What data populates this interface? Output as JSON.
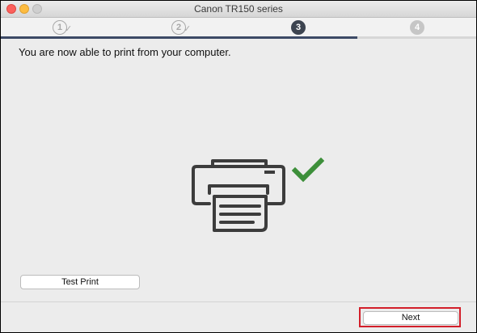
{
  "window": {
    "title": "Canon TR150 series"
  },
  "steps": [
    {
      "number": "1",
      "state": "done"
    },
    {
      "number": "2",
      "state": "done"
    },
    {
      "number": "3",
      "state": "current"
    },
    {
      "number": "4",
      "state": "future"
    }
  ],
  "progress": {
    "current_step": 3,
    "total_steps": 4,
    "fraction": 0.75
  },
  "main": {
    "message": "You are now able to print from your computer.",
    "illustration_icons": [
      "printer-icon",
      "checkmark-icon"
    ],
    "checkmark_color": "#3d8f3a"
  },
  "buttons": {
    "test_print_label": "Test Print",
    "next_label": "Next"
  },
  "colors": {
    "accent": "#3d4a66",
    "highlight": "#d31f2a"
  }
}
